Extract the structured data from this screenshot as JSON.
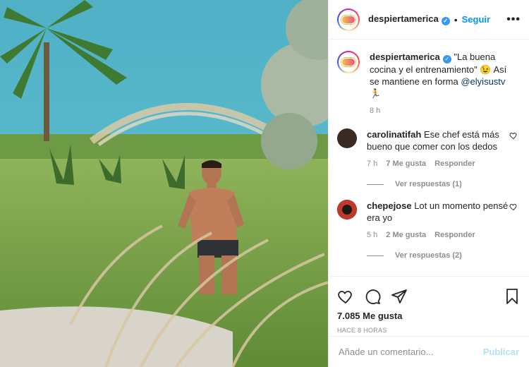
{
  "post": {
    "username": "despiertamerica",
    "follow_label": "Seguir",
    "dot": "•",
    "more_label": "•••",
    "verified_glyph": "✓"
  },
  "caption": {
    "username": "despiertamerica",
    "text": " \"La buena cocina y el entrenamiento\" 😉 Así se mantiene en forma ",
    "mention": "@elyisustv",
    "emoji": "🏃",
    "time": "8 h"
  },
  "comments": [
    {
      "username": "carolinatifah",
      "text": " Ese chef está más bueno que comer con los dedos",
      "time": "7 h",
      "likes": "7 Me gusta",
      "reply": "Responder",
      "view_replies": "Ver respuestas (1)",
      "avatar_color": "#3a2a22"
    },
    {
      "username": "chepejose",
      "text": " Lot un momento pensé era yo",
      "time": "5 h",
      "likes": "2 Me gusta",
      "reply": "Responder",
      "view_replies": "Ver respuestas (2)",
      "avatar_color": "#1d1a14"
    }
  ],
  "actions": {
    "likes": "7.085 Me gusta",
    "timestamp": "HACE 8 HORAS"
  },
  "add_comment": {
    "placeholder": "Añade un comentario...",
    "publish": "Publicar"
  },
  "icons": [
    "heart-icon",
    "comment-icon",
    "share-icon",
    "bookmark-icon"
  ],
  "colors": {
    "link": "#0095f6",
    "verified": "#3897f0",
    "muted": "#8e8e8e",
    "publish_disabled": "#b2dffc"
  }
}
